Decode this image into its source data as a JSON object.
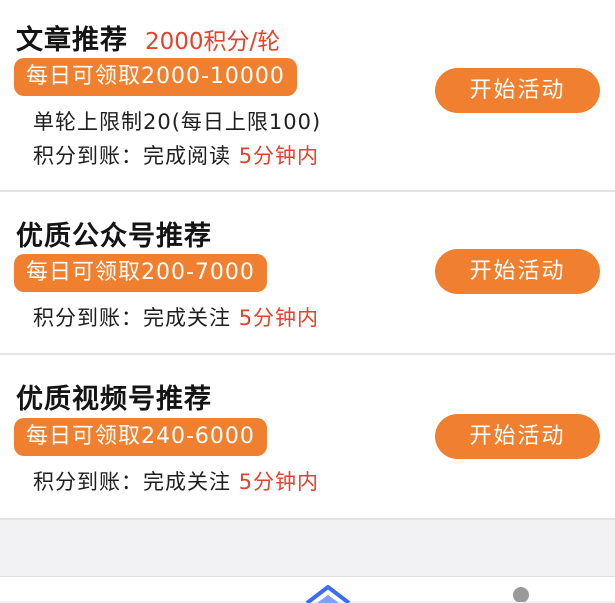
{
  "cards": [
    {
      "title": "文章推荐",
      "rate": "2000积分/轮",
      "daily": "每日可领取2000-10000",
      "limit": "单轮上限制20(每日上限100)",
      "credit_prefix": "积分到账：完成阅读",
      "credit_time": "5分钟内",
      "button": "开始活动"
    },
    {
      "title": "优质公众号推荐",
      "daily": "每日可领取200-7000",
      "credit_prefix": "积分到账：完成关注",
      "credit_time": "5分钟内",
      "button": "开始活动"
    },
    {
      "title": "优质视频号推荐",
      "daily": "每日可领取240-6000",
      "credit_prefix": "积分到账：完成关注",
      "credit_time": "5分钟内",
      "button": "开始活动"
    }
  ],
  "tabbar": {
    "icons": [
      "home-icon",
      "profile-icon"
    ],
    "active_color": "#3a6df0"
  },
  "colors": {
    "accent": "#f08030",
    "highlight": "#e5412c"
  }
}
